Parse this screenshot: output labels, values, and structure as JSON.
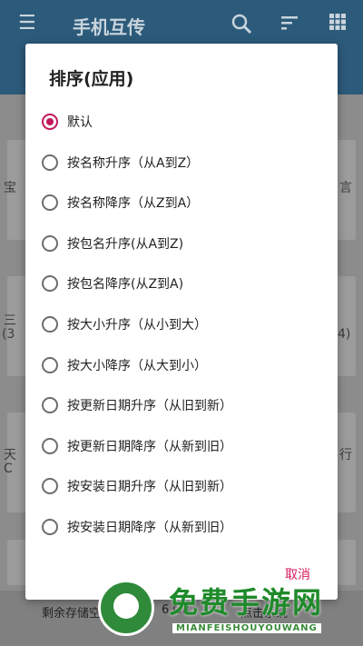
{
  "app": {
    "title": "手机互传",
    "edge_texts": [
      "宝",
      "言",
      "三",
      "(3",
      "4)",
      "天",
      "行",
      "C"
    ]
  },
  "icons": {
    "menu": "menu-icon",
    "search": "search-icon",
    "sort": "sort-icon",
    "grid": "grid-icon"
  },
  "dialog": {
    "title": "排序(应用)",
    "options": [
      {
        "label": "默认",
        "checked": true
      },
      {
        "label": "按名称升序（从A到Z）",
        "checked": false
      },
      {
        "label": "按名称降序（从Z到A）",
        "checked": false
      },
      {
        "label": "按包名升序(从A到Z)",
        "checked": false
      },
      {
        "label": "按包名降序(从Z到A)",
        "checked": false
      },
      {
        "label": "按大小升序（从小到大）",
        "checked": false
      },
      {
        "label": "按大小降序（从大到小）",
        "checked": false
      },
      {
        "label": "按更新日期升序（从旧到新）",
        "checked": false
      },
      {
        "label": "按更新日期降序（从新到旧）",
        "checked": false
      },
      {
        "label": "按安装日期升序（从旧到新）",
        "checked": false
      },
      {
        "label": "按安装日期降序（从新到旧）",
        "checked": false
      }
    ],
    "cancel": "取消"
  },
  "bottom": {
    "storage": "剩余存储空",
    "storage_value": "6 GB",
    "right_text": "点击系统"
  },
  "watermark": {
    "title": "免费手游网",
    "subtitle": "MIANFEISHOUYOUWANG"
  },
  "colors": {
    "accent": "#c2185b",
    "appbar": "#2c5a7a",
    "watermark_green": "#1e8a2a"
  }
}
